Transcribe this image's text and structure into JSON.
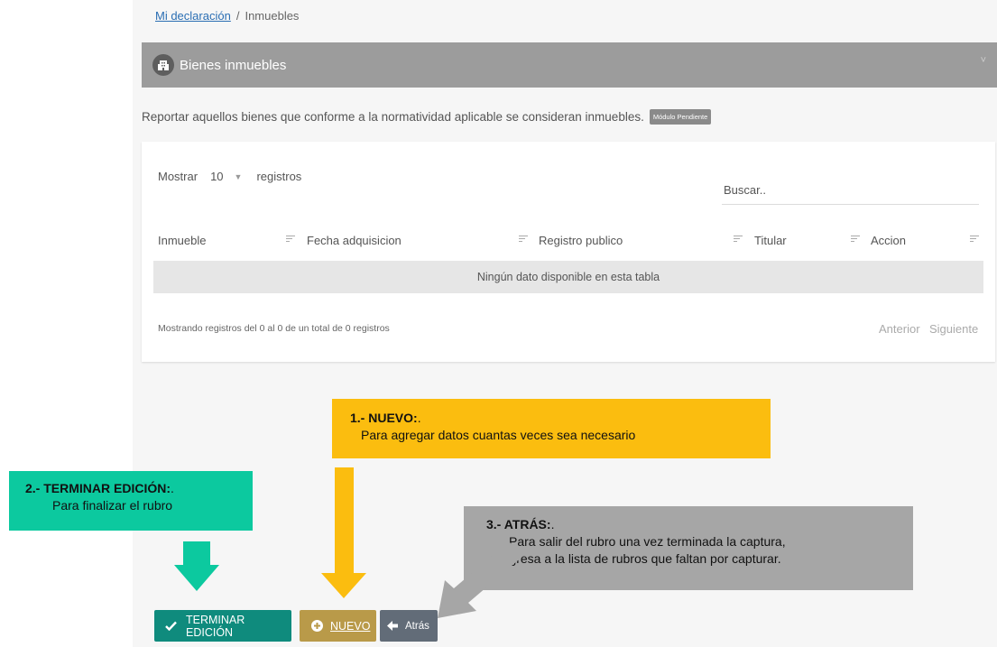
{
  "breadcrumb": {
    "link": "Mi declaración",
    "separator": "/",
    "current": "Inmuebles"
  },
  "section": {
    "title": "Bienes inmuebles",
    "chevron": "˅"
  },
  "description": {
    "text": "Reportar aquellos bienes que conforme a la normatividad aplicable se consideran inmuebles.",
    "badge": "Módulo Pendiente"
  },
  "table": {
    "show_label": "Mostrar",
    "page_size": "10",
    "records_label": "registros",
    "search_placeholder": "Buscar..",
    "columns": [
      "Inmueble",
      "Fecha adquisicion",
      "Registro publico",
      "Titular",
      "Accion"
    ],
    "empty_message": "Ningún dato disponible en esta tabla",
    "info": "Mostrando registros del 0 al 0 de un total de 0 registros",
    "prev": "Anterior",
    "next": "Siguiente"
  },
  "callouts": {
    "nuevo": {
      "title": "1.- NUEVO:",
      "suffix": ".",
      "text": "Para agregar datos cuantas veces sea necesario"
    },
    "terminar": {
      "title": "2.- TERMINAR EDICIÓN:",
      "suffix": ".",
      "text": "Para finalizar el rubro"
    },
    "atras": {
      "title": "3.- ATRÁS:",
      "suffix": ".",
      "text": "Para salir del rubro una vez terminada la captura,",
      "text2": "regresa a la lista de rubros que faltan por capturar."
    }
  },
  "buttons": {
    "finish": "TERMINAR EDICIÓN",
    "new": "NUEVO",
    "back": "Atrás"
  },
  "colors": {
    "finish": "#0f8b7d",
    "new": "#b99a49",
    "back": "#626c78",
    "callout_yellow": "#fbbd0f",
    "callout_green": "#0cc99f",
    "callout_gray": "#a6a6a6"
  },
  "icons": {
    "section": "building-icon",
    "finish": "check-icon",
    "new": "plus-circle-icon",
    "back": "arrow-left-icon"
  }
}
